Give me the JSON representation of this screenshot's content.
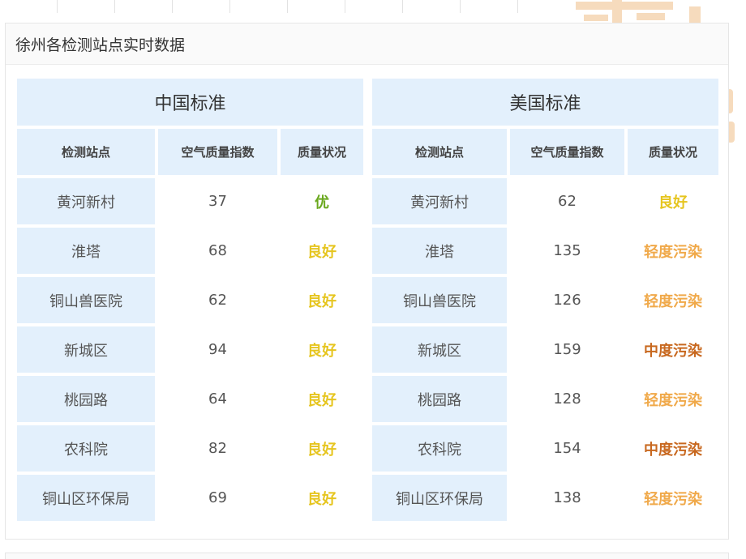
{
  "panel": {
    "title": "徐州各检测站点实时数据"
  },
  "colors": {
    "excellent": "#6aa81e",
    "good": "#e6c51f",
    "light": "#f0a94a",
    "moderate": "#c8681f",
    "header_bg": "#e3f0fc"
  },
  "china": {
    "title": "中国标准",
    "headers": {
      "station": "检测站点",
      "aqi": "空气质量指数",
      "quality": "质量状况"
    },
    "rows": [
      {
        "station": "黄河新村",
        "aqi": "37",
        "quality": "优",
        "level": "excellent"
      },
      {
        "station": "淮塔",
        "aqi": "68",
        "quality": "良好",
        "level": "good"
      },
      {
        "station": "铜山兽医院",
        "aqi": "62",
        "quality": "良好",
        "level": "good"
      },
      {
        "station": "新城区",
        "aqi": "94",
        "quality": "良好",
        "level": "good"
      },
      {
        "station": "桃园路",
        "aqi": "64",
        "quality": "良好",
        "level": "good"
      },
      {
        "station": "农科院",
        "aqi": "82",
        "quality": "良好",
        "level": "good"
      },
      {
        "station": "铜山区环保局",
        "aqi": "69",
        "quality": "良好",
        "level": "good"
      }
    ]
  },
  "usa": {
    "title": "美国标准",
    "headers": {
      "station": "检测站点",
      "aqi": "空气质量指数",
      "quality": "质量状况"
    },
    "rows": [
      {
        "station": "黄河新村",
        "aqi": "62",
        "quality": "良好",
        "level": "good"
      },
      {
        "station": "淮塔",
        "aqi": "135",
        "quality": "轻度污染",
        "level": "light"
      },
      {
        "station": "铜山兽医院",
        "aqi": "126",
        "quality": "轻度污染",
        "level": "light"
      },
      {
        "station": "新城区",
        "aqi": "159",
        "quality": "中度污染",
        "level": "moderate"
      },
      {
        "station": "桃园路",
        "aqi": "128",
        "quality": "轻度污染",
        "level": "light"
      },
      {
        "station": "农科院",
        "aqi": "154",
        "quality": "中度污染",
        "level": "moderate"
      },
      {
        "station": "铜山区环保局",
        "aqi": "138",
        "quality": "轻度污染",
        "level": "light"
      }
    ]
  }
}
